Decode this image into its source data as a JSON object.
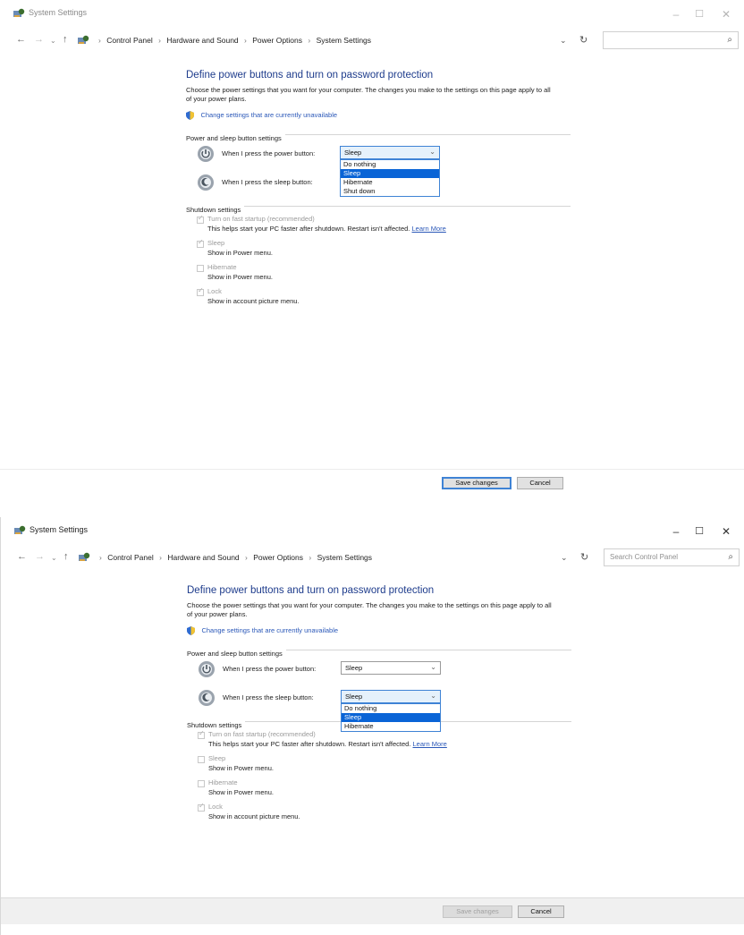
{
  "colors": {
    "title_blue": "#1e3c8c",
    "link_blue": "#2b58b8",
    "selection_blue": "#0a64d6",
    "focus_border": "#3f83d5"
  },
  "icons": {
    "app": "control-panel-icon",
    "back": "back-arrow-icon",
    "forward": "forward-arrow-icon",
    "up": "up-arrow-icon",
    "refresh": "refresh-icon",
    "search": "search-icon",
    "shield": "uac-shield-icon",
    "power": "power-button-icon",
    "sleep": "sleep-button-icon"
  },
  "shot1": {
    "window": {
      "title": "System Settings",
      "minimize": "–",
      "maximize": "☐",
      "close": "✕"
    },
    "address": {
      "breadcrumbs": [
        "Control Panel",
        "Hardware and Sound",
        "Power Options",
        "System Settings"
      ],
      "separator": "›",
      "search_placeholder": ""
    },
    "page_title": "Define power buttons and turn on password protection",
    "description": "Choose the power settings that you want for your computer. The changes you make to the settings on this page apply to all of your power plans.",
    "change_link": "Change settings that are currently unavailable",
    "power_section": "Power and sleep button settings",
    "power_button_label": "When I press the power button:",
    "power_button_value": "Sleep",
    "sleep_button_label": "When I press the sleep button:",
    "sleep_button_value": "",
    "dropdown_options": [
      "Do nothing",
      "Sleep",
      "Hibernate",
      "Shut down"
    ],
    "dropdown_selected": "Sleep",
    "shutdown_section": "Shutdown settings",
    "fast_startup": {
      "title": "Turn on fast startup (recommended)",
      "desc": "This helps start your PC faster after shutdown. Restart isn't affected.",
      "learn_more": "Learn More",
      "checked": true
    },
    "sleep_item": {
      "title": "Sleep",
      "desc": "Show in Power menu.",
      "checked": true
    },
    "hibernate_item": {
      "title": "Hibernate",
      "desc": "Show in Power menu.",
      "checked": false
    },
    "lock_item": {
      "title": "Lock",
      "desc": "Show in account picture menu.",
      "checked": true
    },
    "save_button": "Save changes",
    "cancel_button": "Cancel"
  },
  "shot2": {
    "window": {
      "title": "System Settings",
      "minimize": "–",
      "maximize": "☐",
      "close": "✕"
    },
    "address": {
      "breadcrumbs": [
        "Control Panel",
        "Hardware and Sound",
        "Power Options",
        "System Settings"
      ],
      "separator": "›",
      "search_placeholder": "Search Control Panel"
    },
    "page_title": "Define power buttons and turn on password protection",
    "description": "Choose the power settings that you want for your computer. The changes you make to the settings on this page apply to all of your power plans.",
    "change_link": "Change settings that are currently unavailable",
    "power_section": "Power and sleep button settings",
    "power_button_label": "When I press the power button:",
    "power_button_value": "Sleep",
    "sleep_button_label": "When I press the sleep button:",
    "sleep_button_value": "Sleep",
    "dropdown_options": [
      "Do nothing",
      "Sleep",
      "Hibernate"
    ],
    "dropdown_selected": "Sleep",
    "shutdown_section": "Shutdown settings",
    "fast_startup": {
      "title": "Turn on fast startup (recommended)",
      "desc": "This helps start your PC faster after shutdown. Restart isn't affected.",
      "learn_more": "Learn More",
      "checked": true
    },
    "sleep_item": {
      "title": "Sleep",
      "desc": "Show in Power menu.",
      "checked": false
    },
    "hibernate_item": {
      "title": "Hibernate",
      "desc": "Show in Power menu.",
      "checked": false
    },
    "lock_item": {
      "title": "Lock",
      "desc": "Show in account picture menu.",
      "checked": true
    },
    "save_button": "Save changes",
    "cancel_button": "Cancel"
  }
}
